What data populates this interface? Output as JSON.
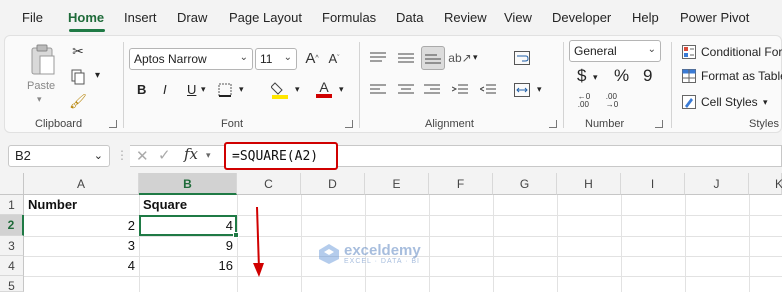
{
  "menu": {
    "tabs": [
      "File",
      "Home",
      "Insert",
      "Draw",
      "Page Layout",
      "Formulas",
      "Data",
      "Review",
      "View",
      "Developer",
      "Help",
      "Power Pivot"
    ],
    "active": "Home"
  },
  "ribbon": {
    "clipboard": {
      "paste_label": "Paste",
      "group_label": "Clipboard"
    },
    "font": {
      "font_name": "Aptos Narrow",
      "font_size": "11",
      "bold": "B",
      "italic": "I",
      "underline": "U",
      "group_label": "Font"
    },
    "alignment": {
      "group_label": "Alignment"
    },
    "number": {
      "format": "General",
      "currency": "$",
      "percent": "%",
      "comma": "9",
      "group_label": "Number"
    },
    "styles": {
      "conditional": "Conditional For",
      "format_table": "Format as Table",
      "cell_styles": "Cell Styles",
      "group_label": "Styles"
    }
  },
  "formula_bar": {
    "name_box": "B2",
    "fx_label": "fx",
    "formula": "=SQUARE(A2)"
  },
  "sheet": {
    "columns": [
      "A",
      "B",
      "C",
      "D",
      "E",
      "F",
      "G",
      "H",
      "I",
      "J",
      "K"
    ],
    "rows": [
      "1",
      "2",
      "3",
      "4",
      "5"
    ],
    "cells": {
      "A1": "Number",
      "B1": "Square",
      "A2": "2",
      "B2": "4",
      "A3": "3",
      "B3": "9",
      "A4": "4",
      "B4": "16"
    }
  },
  "watermark": {
    "brand": "exceldemy",
    "tagline": "EXCEL · DATA · BI"
  },
  "colors": {
    "accent": "#1f7a45",
    "highlight": "#d00000"
  }
}
